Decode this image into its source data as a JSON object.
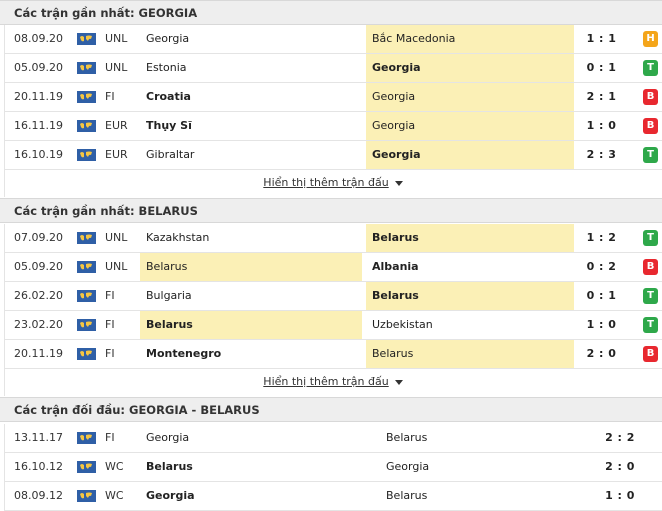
{
  "colors": {
    "win": "#2ea84a",
    "loss": "#e8282f",
    "draw": "#f4a51a",
    "highlight": "#fbf0b6",
    "header": "#eeeeee"
  },
  "icons": {
    "flag": "world-map-flag-icon"
  },
  "section_georgia": {
    "title": "Các trận gần nhất: GEORGIA",
    "rows": [
      {
        "date": "08.09.20",
        "comp": "UNL",
        "home": "Georgia",
        "away": "Bắc Macedonia",
        "score": "1 : 1",
        "result": "H"
      },
      {
        "date": "05.09.20",
        "comp": "UNL",
        "home": "Estonia",
        "away": "Georgia",
        "score": "0 : 1",
        "result": "T"
      },
      {
        "date": "20.11.19",
        "comp": "FI",
        "home": "Croatia",
        "away": "Georgia",
        "score": "2 : 1",
        "result": "B"
      },
      {
        "date": "16.11.19",
        "comp": "EUR",
        "home": "Thụy Sĩ",
        "away": "Georgia",
        "score": "1 : 0",
        "result": "B"
      },
      {
        "date": "16.10.19",
        "comp": "EUR",
        "home": "Gibraltar",
        "away": "Georgia",
        "score": "2 : 3",
        "result": "T"
      }
    ],
    "more": "Hiển thị thêm trận đấu"
  },
  "section_belarus": {
    "title": "Các trận gần nhất: BELARUS",
    "rows": [
      {
        "date": "07.09.20",
        "comp": "UNL",
        "home": "Kazakhstan",
        "away": "Belarus",
        "score": "1 : 2",
        "result": "T"
      },
      {
        "date": "05.09.20",
        "comp": "UNL",
        "home": "Belarus",
        "away": "Albania",
        "score": "0 : 2",
        "result": "B"
      },
      {
        "date": "26.02.20",
        "comp": "FI",
        "home": "Bulgaria",
        "away": "Belarus",
        "score": "0 : 1",
        "result": "T"
      },
      {
        "date": "23.02.20",
        "comp": "FI",
        "home": "Belarus",
        "away": "Uzbekistan",
        "score": "1 : 0",
        "result": "T"
      },
      {
        "date": "20.11.19",
        "comp": "FI",
        "home": "Montenegro",
        "away": "Belarus",
        "score": "2 : 0",
        "result": "B"
      }
    ],
    "more": "Hiển thị thêm trận đấu"
  },
  "section_h2h": {
    "title": "Các trận đối đầu: GEORGIA - BELARUS",
    "rows": [
      {
        "date": "13.11.17",
        "comp": "FI",
        "home": "Georgia",
        "away": "Belarus",
        "score": "2 : 2"
      },
      {
        "date": "16.10.12",
        "comp": "WC",
        "home": "Belarus",
        "away": "Georgia",
        "score": "2 : 0"
      },
      {
        "date": "08.09.12",
        "comp": "WC",
        "home": "Georgia",
        "away": "Belarus",
        "score": "1 : 0"
      }
    ]
  }
}
